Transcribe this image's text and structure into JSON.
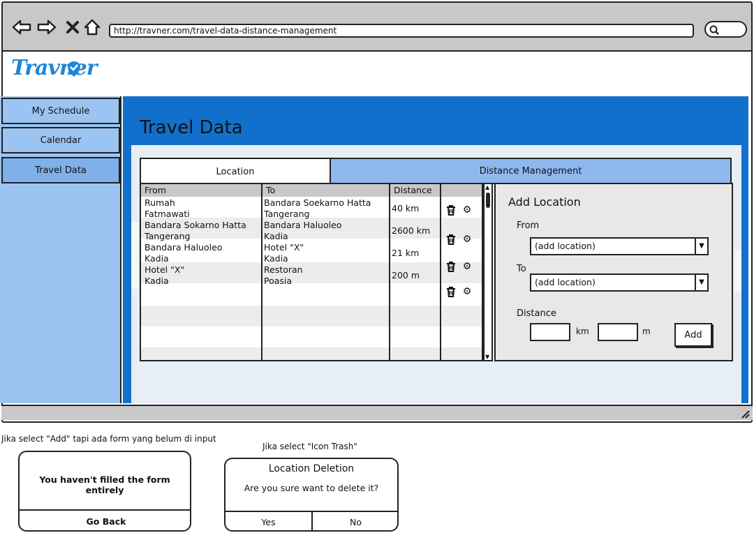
{
  "browser": {
    "url": "http://travner.com/travel-data-distance-management"
  },
  "brand": {
    "logo_text": "Travner",
    "accent": "#1170cc"
  },
  "sidebar": {
    "items": [
      {
        "label": "My Schedule"
      },
      {
        "label": "Calendar"
      },
      {
        "label": "Travel Data"
      }
    ]
  },
  "main": {
    "title": "Travel Data",
    "tabs": [
      {
        "label": "Location"
      },
      {
        "label": "Distance Management"
      }
    ]
  },
  "table": {
    "headers": [
      "From",
      "To",
      "Distance"
    ],
    "rows": [
      {
        "from1": "Rumah",
        "from2": "Fatmawati",
        "to1": "Bandara Soekarno Hatta",
        "to2": "Tangerang",
        "distance": "40 km"
      },
      {
        "from1": "Bandara Sokarno Hatta",
        "from2": "Tangerang",
        "to1": "Bandara Haluoleo",
        "to2": "Kadia",
        "distance": "2600 km"
      },
      {
        "from1": "Bandara Haluoleo",
        "from2": "Kadia",
        "to1": "Hotel \"X\"",
        "to2": "Kadia",
        "distance": "21 km"
      },
      {
        "from1": "Hotel \"X\"",
        "from2": "Kadia",
        "to1": "Restoran",
        "to2": "Poasia",
        "distance": "200 m"
      }
    ],
    "row_icons": [
      "trash-icon",
      "gear-icon"
    ]
  },
  "add_location": {
    "title": "Add Location",
    "from_label": "From",
    "from_value": "(add location)",
    "to_label": "To",
    "to_value": "(add location)",
    "distance_label": "Distance",
    "km_unit": "km",
    "m_unit": "m",
    "add_label": "Add"
  },
  "dialog_incomplete": {
    "caption": "Jika select \"Add\" tapi ada form yang belum di input",
    "message": "You haven't filled the form entirely",
    "button": "Go Back"
  },
  "dialog_delete": {
    "caption": "Jika select \"Icon Trash\"",
    "title": "Location Deletion",
    "message": "Are you sure want to delete it?",
    "yes": "Yes",
    "no": "No"
  }
}
